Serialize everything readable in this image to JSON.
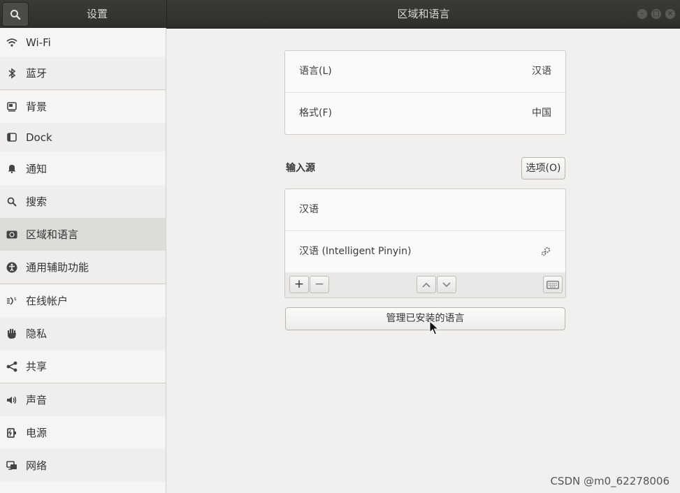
{
  "titlebar": {
    "left_title": "设置",
    "main_title": "区域和语言",
    "search_icon": "search-icon",
    "window_buttons": [
      "minimize-icon",
      "maximize-icon",
      "close-icon"
    ]
  },
  "sidebar": {
    "items": [
      {
        "label": "Wi-Fi",
        "icon": "wifi-icon"
      },
      {
        "label": "蓝牙",
        "icon": "bluetooth-icon"
      },
      {
        "label": "背景",
        "icon": "background-icon"
      },
      {
        "label": "Dock",
        "icon": "dock-icon"
      },
      {
        "label": "通知",
        "icon": "bell-icon"
      },
      {
        "label": "搜索",
        "icon": "search-icon"
      },
      {
        "label": "区域和语言",
        "icon": "region-icon"
      },
      {
        "label": "通用辅助功能",
        "icon": "accessibility-icon"
      },
      {
        "label": "在线帐户",
        "icon": "online-accounts-icon"
      },
      {
        "label": "隐私",
        "icon": "privacy-hand-icon"
      },
      {
        "label": "共享",
        "icon": "share-icon"
      },
      {
        "label": "声音",
        "icon": "speaker-icon"
      },
      {
        "label": "电源",
        "icon": "power-icon"
      },
      {
        "label": "网络",
        "icon": "network-icon"
      }
    ],
    "selected": "区域和语言"
  },
  "main": {
    "language": {
      "label": "语言(L)",
      "value": "汉语"
    },
    "format": {
      "label": "格式(F)",
      "value": "中国"
    },
    "input_sources_title": "输入源",
    "options_button": "选项(O)",
    "input_sources": [
      {
        "label": "汉语"
      },
      {
        "label": "汉语 (Intelligent Pinyin)",
        "icon": "gear-icon"
      }
    ],
    "toolbar": {
      "add": "+",
      "remove": "−",
      "up_icon": "chevron-up-icon",
      "down_icon": "chevron-down-icon",
      "keyboard_icon": "keyboard-icon"
    },
    "manage_button": "管理已安装的语言"
  },
  "watermark": "CSDN @m0_62278006",
  "colors": {
    "titlebar": "#2e2e2b",
    "sidebar_bg": "#f6f5f4",
    "selected_bg": "#dddcd9",
    "content_bg": "#f1f0ee"
  }
}
